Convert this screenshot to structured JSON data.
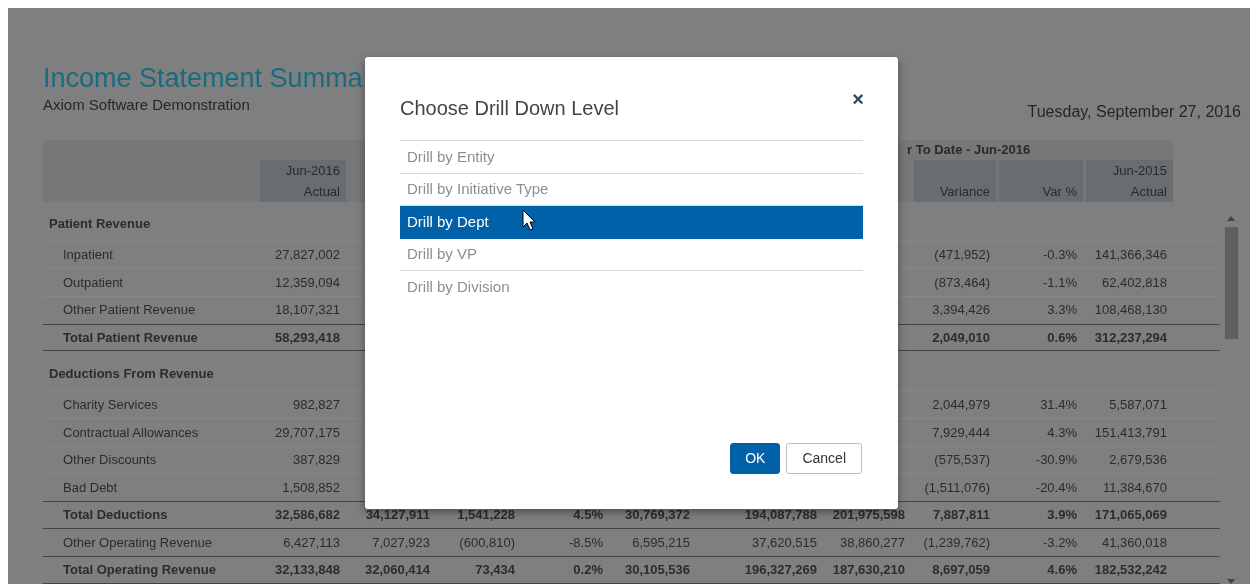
{
  "report": {
    "title": "Income Statement Summa",
    "subtitle": "Axiom Software Demonstration",
    "date": "Tuesday, September 27, 2016"
  },
  "table": {
    "group_header": "r To Date - Jun-2016",
    "headers": {
      "column_2": {
        "label": "Jun-2016",
        "sublabel": "Actual"
      },
      "column_9": {
        "sublabel": "Variance"
      },
      "column_10": {
        "sublabel": "Var %"
      },
      "column_11": {
        "label": "Jun-2015",
        "sublabel": "Actual"
      }
    },
    "rows": [
      {
        "kind": "section",
        "label": "Patient Revenue"
      },
      {
        "kind": "item",
        "label": "Inpatient",
        "column_2": "27,827,002",
        "column_9": "(471,952)",
        "column_10": "-0.3%",
        "column_11": "141,366,346"
      },
      {
        "kind": "item",
        "label": "Outpatient",
        "column_2": "12,359,094",
        "column_9": "(873,464)",
        "column_10": "-1.1%",
        "column_11": "62,402,818"
      },
      {
        "kind": "item",
        "label": "Other Patient Revenue",
        "column_2": "18,107,321",
        "column_9": "3,394,426",
        "column_10": "3.3%",
        "column_11": "108,468,130"
      },
      {
        "kind": "total",
        "label": "Total Patient Revenue",
        "column_2": "58,293,418",
        "column_9": "2,049,010",
        "column_10": "0.6%",
        "column_11": "312,237,294"
      },
      {
        "kind": "section",
        "label": "Deductions From Revenue"
      },
      {
        "kind": "item",
        "label": "Charity Services",
        "column_2": "982,827",
        "column_9": "2,044,979",
        "column_10": "31.4%",
        "column_11": "5,587,071"
      },
      {
        "kind": "item",
        "label": "Contractual Allowances",
        "column_2": "29,707,175",
        "column_9": "7,929,444",
        "column_10": "4.3%",
        "column_11": "151,413,791"
      },
      {
        "kind": "item",
        "label": "Other Discounts",
        "column_2": "387,829",
        "column_9": "(575,537)",
        "column_10": "-30.9%",
        "column_11": "2,679,536"
      },
      {
        "kind": "item",
        "label": "Bad Debt",
        "column_2": "1,508,852",
        "column_9": "(1,511,076)",
        "column_10": "-20.4%",
        "column_11": "11,384,670"
      },
      {
        "kind": "total",
        "label": "Total Deductions",
        "column_2": "32,586,682",
        "column_3": "34,127,911",
        "column_4": "1,541,228",
        "column_5": "4.5%",
        "column_6": "30,769,372",
        "column_7": "194,087,788",
        "column_8": "201,975,598",
        "column_9": "7,887,811",
        "column_10": "3.9%",
        "column_11": "171,065,069"
      },
      {
        "kind": "item",
        "label": "Other Operating Revenue",
        "column_2": "6,427,113",
        "column_3": "7,027,923",
        "column_4": "(600,810)",
        "column_5": "-8.5%",
        "column_6": "6,595,215",
        "column_7": "37,620,515",
        "column_8": "38,860,277",
        "column_9": "(1,239,762)",
        "column_10": "-3.2%",
        "column_11": "41,360,018"
      },
      {
        "kind": "total",
        "label": "Total Operating Revenue",
        "column_2": "32,133,848",
        "column_3": "32,060,414",
        "column_4": "73,434",
        "column_5": "0.2%",
        "column_6": "30,105,536",
        "column_7": "196,327,269",
        "column_8": "187,630,210",
        "column_9": "8,697,059",
        "column_10": "4.6%",
        "column_11": "182,532,242"
      }
    ]
  },
  "dialog": {
    "title": "Choose Drill Down Level",
    "close": "×",
    "options": [
      {
        "label": "Drill by Entity",
        "selected": false
      },
      {
        "label": "Drill by Initiative Type",
        "selected": false
      },
      {
        "label": "Drill by Dept",
        "selected": true
      },
      {
        "label": "Drill by VP",
        "selected": false
      },
      {
        "label": "Drill by Division",
        "selected": false
      }
    ],
    "buttons": [
      {
        "label": "OK",
        "kind": "primary"
      },
      {
        "label": "Cancel",
        "kind": "secondary"
      }
    ]
  }
}
